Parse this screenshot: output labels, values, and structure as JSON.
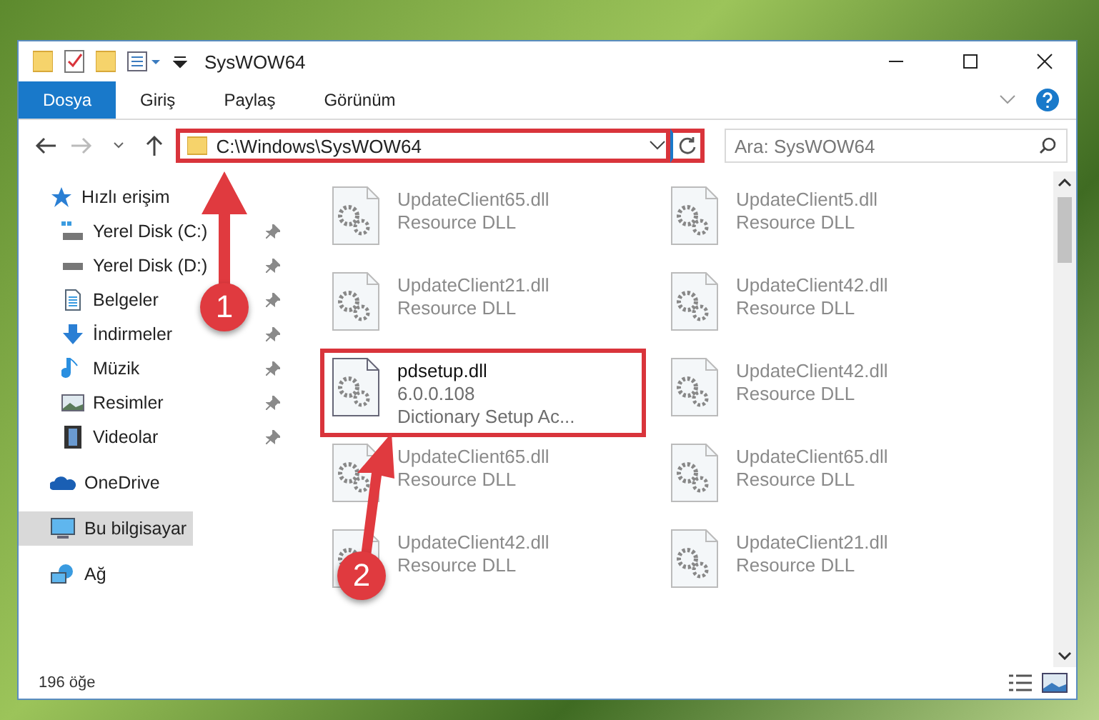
{
  "window": {
    "title": "SysWOW64"
  },
  "ribbon_tabs": [
    {
      "label": "Dosya",
      "kind": "file"
    },
    {
      "label": "Giriş",
      "kind": "tab"
    },
    {
      "label": "Paylaş",
      "kind": "tab"
    },
    {
      "label": "Görünüm",
      "kind": "tab"
    }
  ],
  "address_bar": {
    "path": "C:\\Windows\\SysWOW64",
    "highlighted": true
  },
  "search": {
    "placeholder": "Ara: SysWOW64"
  },
  "navigation": [
    {
      "label": "Hızlı erişim",
      "selected": false,
      "children": [
        {
          "label": "Yerel Disk (C:)",
          "selected": false,
          "pinned": true
        },
        {
          "label": "Yerel Disk (D:)",
          "selected": false,
          "pinned": true
        },
        {
          "label": "Belgeler",
          "selected": false,
          "pinned": true
        },
        {
          "label": "İndirmeler",
          "selected": false,
          "pinned": true
        },
        {
          "label": "Müzik",
          "selected": false,
          "pinned": true
        },
        {
          "label": "Resimler",
          "selected": false,
          "pinned": true
        },
        {
          "label": "Videolar",
          "selected": false,
          "pinned": true
        }
      ]
    },
    {
      "label": "OneDrive",
      "selected": false
    },
    {
      "label": "Bu bilgisayar",
      "selected": true
    },
    {
      "label": "Ağ",
      "selected": false
    }
  ],
  "files": [
    {
      "name": "UpdateClient65.dll",
      "details": [
        "Resource DLL"
      ],
      "blurred": true,
      "highlighted": false
    },
    {
      "name": "UpdateClient5.dll",
      "details": [
        "Resource DLL"
      ],
      "blurred": true,
      "highlighted": false
    },
    {
      "name": "UpdateClient21.dll",
      "details": [
        "Resource DLL"
      ],
      "blurred": true,
      "highlighted": false
    },
    {
      "name": "UpdateClient42.dll",
      "details": [
        "Resource DLL"
      ],
      "blurred": true,
      "highlighted": false
    },
    {
      "name": "pdsetup.dll",
      "details": [
        "6.0.0.108",
        "Dictionary Setup Ac..."
      ],
      "blurred": false,
      "highlighted": true
    },
    {
      "name": "UpdateClient42.dll",
      "details": [
        "Resource DLL"
      ],
      "blurred": true,
      "highlighted": false
    },
    {
      "name": "UpdateClient65.dll",
      "details": [
        "Resource DLL"
      ],
      "blurred": true,
      "highlighted": false
    },
    {
      "name": "UpdateClient65.dll",
      "details": [
        "Resource DLL"
      ],
      "blurred": true,
      "highlighted": false
    },
    {
      "name": "UpdateClient42.dll",
      "details": [
        "Resource DLL"
      ],
      "blurred": true,
      "highlighted": false
    },
    {
      "name": "UpdateClient21.dll",
      "details": [
        "Resource DLL"
      ],
      "blurred": true,
      "highlighted": false
    }
  ],
  "status_bar": {
    "item_count": "196 öğe"
  },
  "annotations": [
    {
      "number": "1"
    },
    {
      "number": "2"
    }
  ]
}
